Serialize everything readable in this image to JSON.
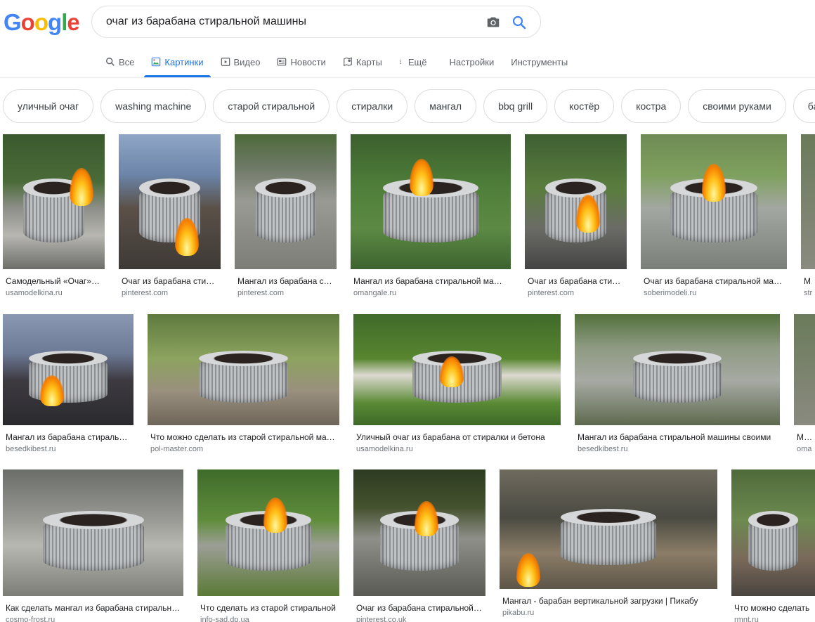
{
  "header": {
    "logo_letters": [
      "G",
      "o",
      "o",
      "g",
      "l",
      "e"
    ],
    "logo_colors": [
      "#4285f4",
      "#ea4335",
      "#fbbc05",
      "#4285f4",
      "#34a853",
      "#ea4335"
    ],
    "search_value": "очаг из барабана стиральной машины"
  },
  "nav": {
    "items": [
      {
        "label": "Все",
        "icon": "search-icon"
      },
      {
        "label": "Картинки",
        "icon": "image-icon"
      },
      {
        "label": "Видео",
        "icon": "play-icon"
      },
      {
        "label": "Новости",
        "icon": "news-icon"
      },
      {
        "label": "Карты",
        "icon": "map-pin-icon"
      },
      {
        "label": "Ещё",
        "icon": "more-vert-icon"
      },
      {
        "label": "Настройки",
        "icon": ""
      },
      {
        "label": "Инструменты",
        "icon": ""
      }
    ]
  },
  "chips": [
    "уличный очаг",
    "washing machine",
    "старой стиральной",
    "стиралки",
    "мангал",
    "bbq grill",
    "костёр",
    "костра",
    "своими руками",
    "ба"
  ],
  "results": [
    {
      "caption": "Самодельный «Очаг» из барабана",
      "source": "usamodelkina.ru"
    },
    {
      "caption": "Очаг из барабана стиральной",
      "source": "pinterest.com"
    },
    {
      "caption": "Мангал из барабана стиральной",
      "source": "pinterest.com"
    },
    {
      "caption": "Мангал из барабана стиральной машины",
      "source": "omangale.ru"
    },
    {
      "caption": "Очаг из барабана стиральной",
      "source": "pinterest.com"
    },
    {
      "caption": "Очаг из барабана стиральной машины",
      "source": "soberimodeli.ru"
    },
    {
      "caption": "Ма",
      "source": "stro"
    },
    {
      "caption": "Мангал из барабана стиральной",
      "source": "besedkibest.ru"
    },
    {
      "caption": "Что можно сделать из старой стиральной машины",
      "source": "pol-master.com"
    },
    {
      "caption": "Уличный очаг из барабана от стиралки и бетона",
      "source": "usamodelkina.ru"
    },
    {
      "caption": "Мангал из барабана стиральной машины своими",
      "source": "besedkibest.ru"
    },
    {
      "caption": "Манг",
      "source": "omar"
    },
    {
      "caption": "Как сделать мангал из барабана стиральной",
      "source": "cosmo-frost.ru"
    },
    {
      "caption": "Что сделать из старой стиральной",
      "source": "info-sad.dp.ua"
    },
    {
      "caption": "Очаг из барабана стиральной машины",
      "source": "pinterest.co.uk"
    },
    {
      "caption": "Мангал - барабан вертикальной загрузки | Пикабу",
      "source": "pikabu.ru"
    },
    {
      "caption": "Что можно сделать",
      "source": "rmnt.ru"
    }
  ],
  "colors": {
    "accent": "#1a73e8",
    "chip_border": "#dadce0",
    "source_text": "#70757a"
  }
}
